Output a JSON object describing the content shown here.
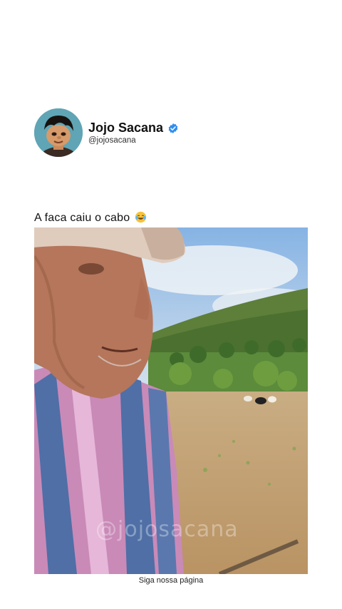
{
  "profile": {
    "name": "Jojo Sacana",
    "handle": "@jojosacana",
    "verified": true,
    "avatar_icon": "cartoon-boy-avatar",
    "verified_color": "#2f8df0"
  },
  "post": {
    "caption": "A faca caiu o cabo",
    "caption_emoji": "face-with-tears-of-joy",
    "video_watermark": "@jojosacana",
    "footer": "Siga nossa página"
  }
}
